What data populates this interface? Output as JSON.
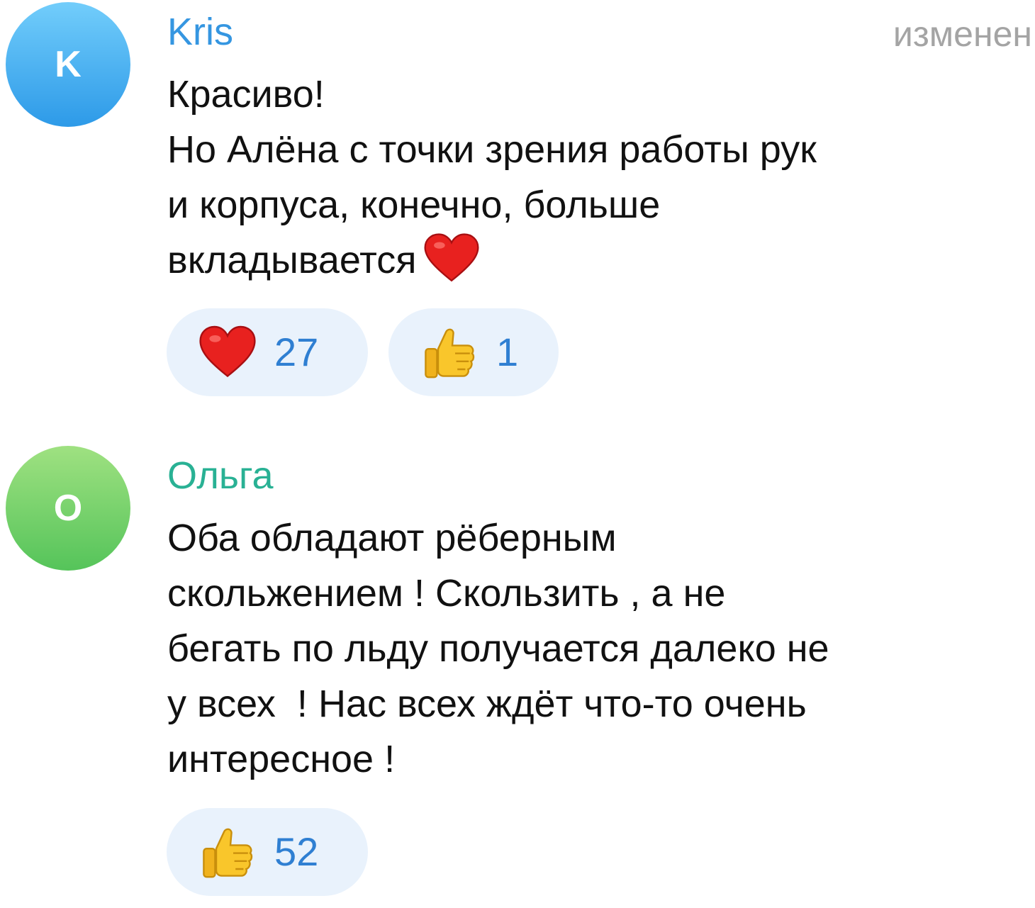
{
  "comments": [
    {
      "avatar_letter": "K",
      "author": "Kris",
      "edited": "изменен",
      "lines": [
        "Красиво!",
        "Но Алёна с точки зрения работы рук",
        "и корпуса, конечно, больше",
        "вкладывается"
      ],
      "inline_icon": "red-heart-icon",
      "reactions": [
        {
          "icon": "red-heart-icon",
          "count": "27"
        },
        {
          "icon": "thumbs-up-icon",
          "count": "1"
        }
      ],
      "author_color": "#3596e1"
    },
    {
      "avatar_letter": "О",
      "author": "Ольга",
      "lines": [
        "Оба обладают рёберным",
        "скольжением ! Скользить , а не",
        "бегать по льду получается далеко не",
        "у всех  ! Нас всех ждёт что-то очень",
        "интересное !"
      ],
      "reactions": [
        {
          "icon": "thumbs-up-icon",
          "count": "52"
        }
      ],
      "author_color": "#29b194"
    }
  ],
  "colors": {
    "reaction_bg": "#e9f2fc",
    "reaction_count": "#2f7fd2",
    "edited_label": "#a4a4a4"
  }
}
